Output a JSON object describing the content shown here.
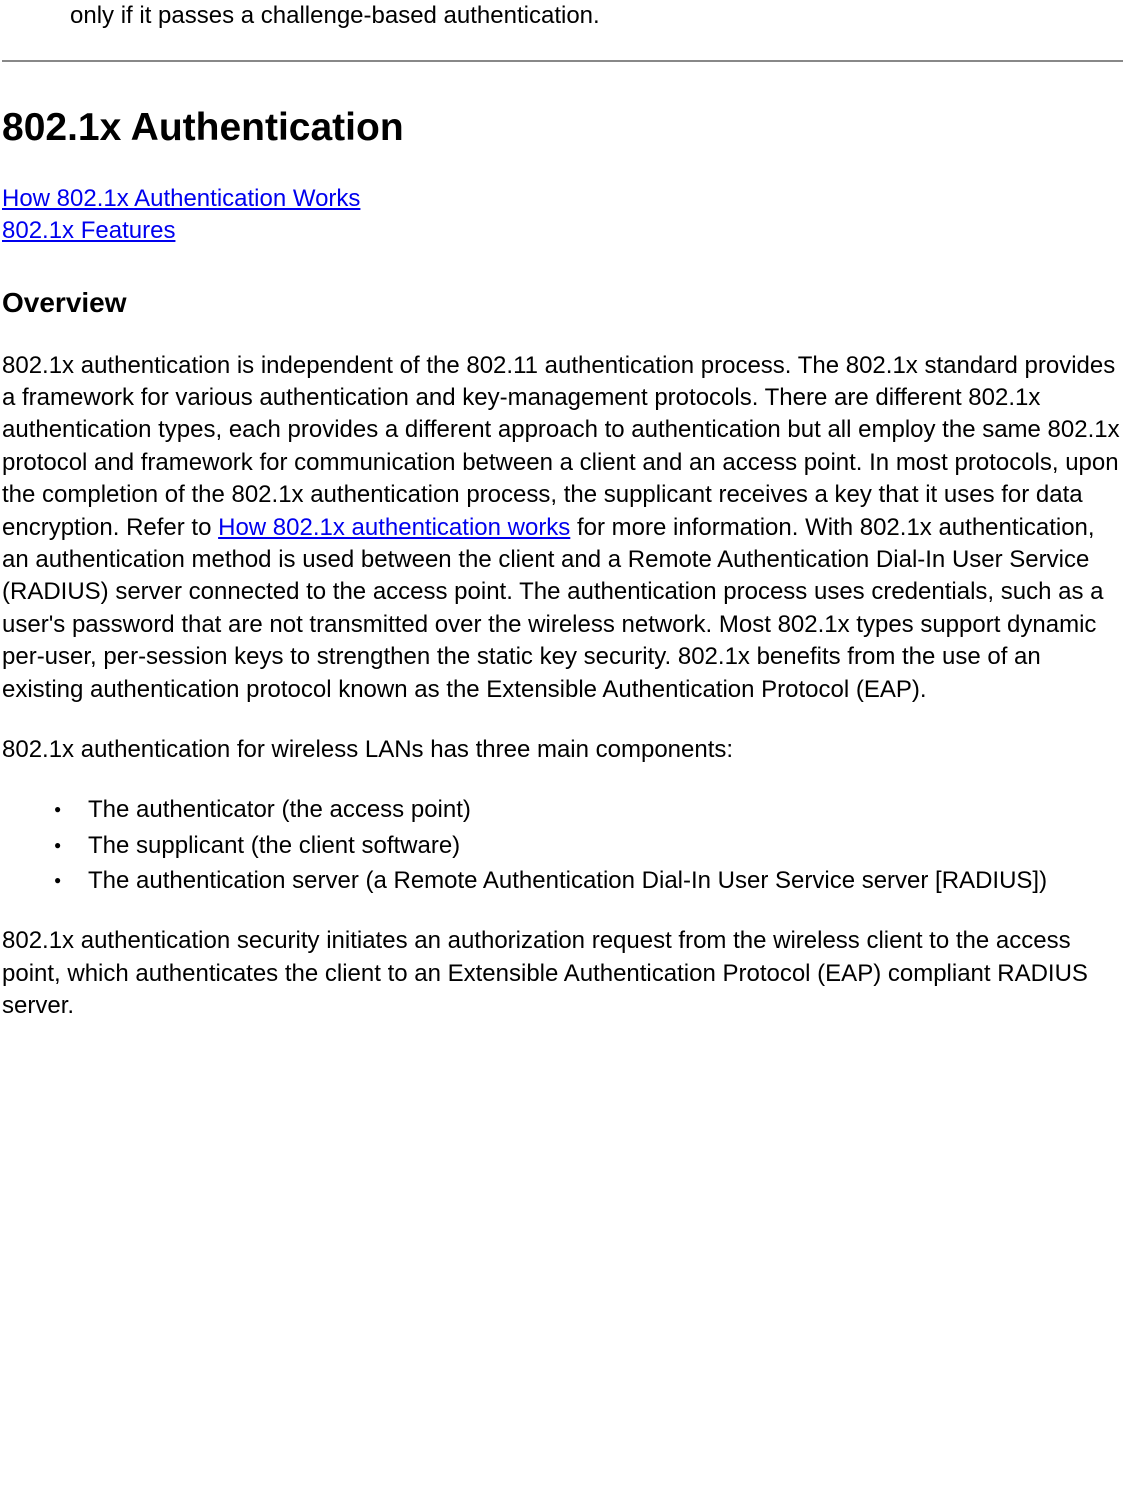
{
  "introFragment": "only if it passes a challenge-based authentication.",
  "section": {
    "heading": "802.1x Authentication",
    "links": [
      "How 802.1x Authentication Works",
      "802.1x Features"
    ],
    "overview": {
      "heading": "Overview",
      "para1_part1": "802.1x authentication is independent of the 802.11 authentication process. The 802.1x standard provides a framework for various authentication and key-management protocols. There are different 802.1x authentication types, each provides a different approach to authentication but all employ the same 802.1x protocol and framework for communication between a client and an access point. In most protocols, upon the completion of the 802.1x authentication process, the supplicant receives a key that it uses for data encryption. Refer to ",
      "para1_link": "How 802.1x authentication works",
      "para1_part2": " for more information. With 802.1x authentication, an authentication method is used between the client and a Remote Authentication Dial-In User Service (RADIUS) server connected to the access point. The authentication process uses credentials, such as a user's password that are not transmitted over the wireless network. Most 802.1x types support dynamic per-user, per-session keys to strengthen the static key security. 802.1x benefits from the use of an existing authentication protocol known as the Extensible Authentication Protocol (EAP).",
      "para2": "802.1x authentication for wireless LANs has three main components:",
      "componentsList": [
        "The authenticator (the access point)",
        "The supplicant (the client software)",
        "The authentication server (a Remote Authentication Dial-In User Service server [RADIUS])"
      ],
      "para3": "802.1x authentication security initiates an authorization request from the wireless client to the access point, which authenticates the client to an Extensible Authentication Protocol (EAP) compliant RADIUS server."
    }
  }
}
